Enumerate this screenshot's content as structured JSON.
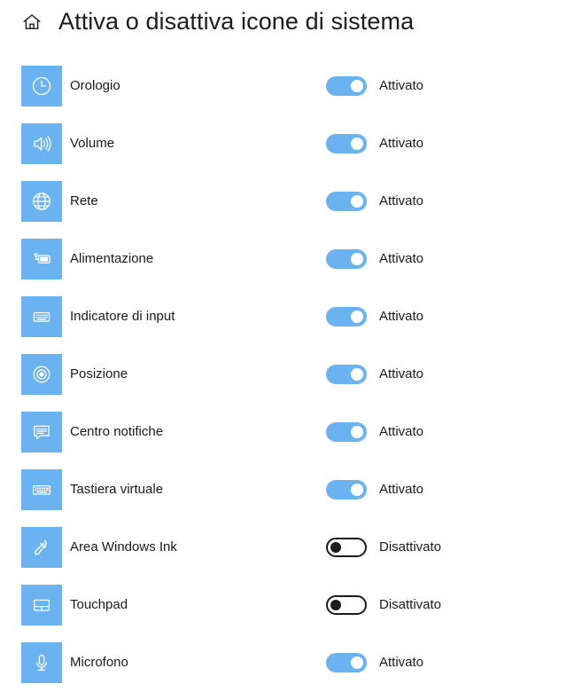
{
  "header": {
    "home_icon": "home-icon",
    "title": "Attiva o disattiva icone di sistema"
  },
  "theme": {
    "icon_tile_bg": "#6bb2f0",
    "toggle_on_bg": "#6bb2f0",
    "toggle_off_border": "#1b1b1b",
    "text": "#1a1a1a",
    "page_bg": "#ffffff"
  },
  "rows": [
    {
      "icon": "clock-icon",
      "label": "Orologio",
      "state": "on",
      "status": "Attivato"
    },
    {
      "icon": "volume-icon",
      "label": "Volume",
      "state": "on",
      "status": "Attivato"
    },
    {
      "icon": "network-globe-icon",
      "label": "Rete",
      "state": "on",
      "status": "Attivato"
    },
    {
      "icon": "battery-power-icon",
      "label": "Alimentazione",
      "state": "on",
      "status": "Attivato"
    },
    {
      "icon": "input-indicator-icon",
      "label": "Indicatore di input",
      "state": "on",
      "status": "Attivato"
    },
    {
      "icon": "location-icon",
      "label": "Posizione",
      "state": "on",
      "status": "Attivato"
    },
    {
      "icon": "action-center-icon",
      "label": "Centro notifiche",
      "state": "on",
      "status": "Attivato"
    },
    {
      "icon": "keyboard-icon",
      "label": "Tastiera virtuale",
      "state": "on",
      "status": "Attivato"
    },
    {
      "icon": "pen-ink-icon",
      "label": "Area Windows Ink",
      "state": "off",
      "status": "Disattivato"
    },
    {
      "icon": "touchpad-icon",
      "label": "Touchpad",
      "state": "off",
      "status": "Disattivato"
    },
    {
      "icon": "microphone-icon",
      "label": "Microfono",
      "state": "on",
      "status": "Attivato"
    }
  ]
}
